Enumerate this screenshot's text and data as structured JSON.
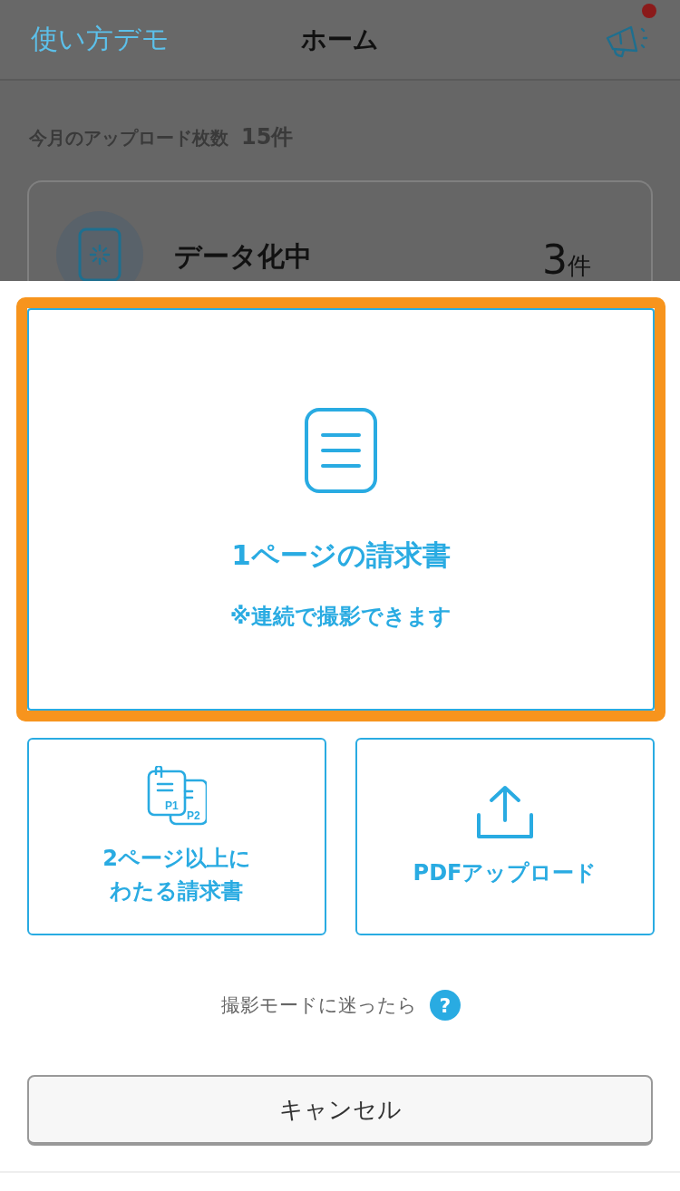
{
  "header": {
    "back_link": "使い方デモ",
    "title": "ホーム",
    "notification": true
  },
  "summary": {
    "label": "今月のアップロード枚数",
    "count": "15件"
  },
  "status_card": {
    "label": "データ化中",
    "count": "3",
    "unit": "件"
  },
  "options": [
    {
      "kind": "single",
      "lines": [
        "1ページの請求書"
      ],
      "note": "※連続で撮影できます",
      "highlighted": true
    },
    {
      "kind": "multi",
      "lines": [
        "2ページ以上に",
        "わたる請求書"
      ],
      "icon_labels": [
        "P1",
        "P2"
      ],
      "highlighted": false
    },
    {
      "kind": "pdf",
      "lines": [
        "PDFアップロード"
      ],
      "highlighted": false
    }
  ],
  "help": {
    "text": "撮影モードに迷ったら",
    "icon": "?"
  },
  "cancel": "キャンセル"
}
